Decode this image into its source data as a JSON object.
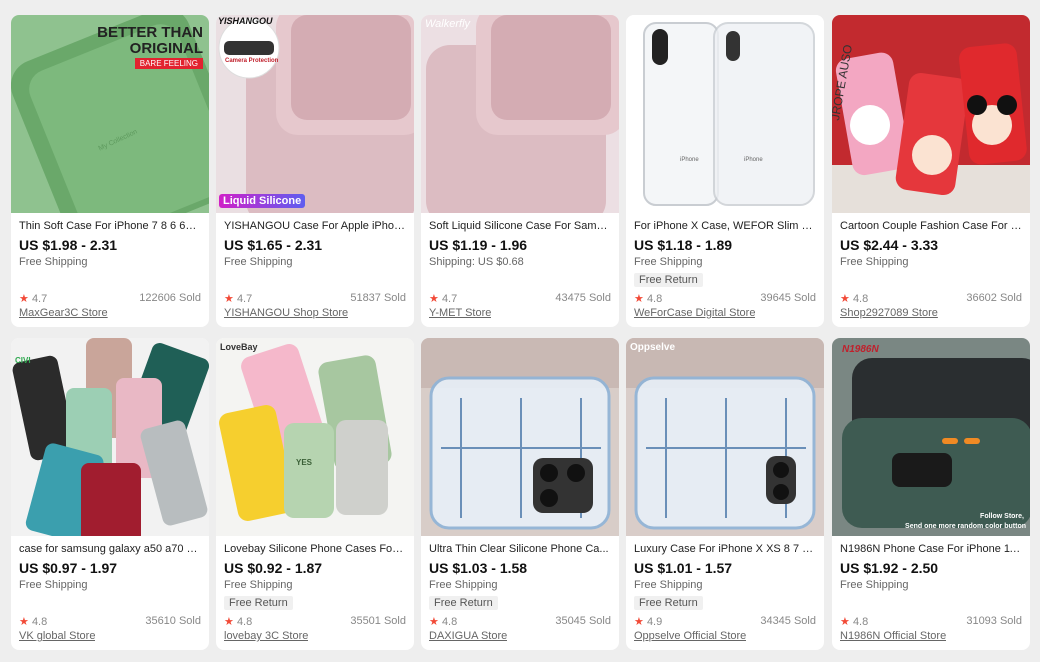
{
  "colors": {
    "price": "#111111",
    "star": "#f24a37",
    "background": "#eeeeee",
    "card": "#ffffff"
  },
  "products": [
    {
      "title": "Thin Soft Case For iPhone 7 8 6 6s ...",
      "price": "US $1.98 - 2.31",
      "shipping": "Free Shipping",
      "badge": "",
      "rating": "4.7",
      "sold": "122606 Sold",
      "store": "MaxGear3C Store",
      "overlay": {
        "headline1": "BETTER THAN",
        "headline2": "ORIGINAL",
        "tag": "BARE FEELING",
        "case_text": "My Collection"
      }
    },
    {
      "title": "YISHANGOU Case For Apple iPhon...",
      "price": "US $1.65 - 2.31",
      "shipping": "Free Shipping",
      "badge": "",
      "rating": "4.7",
      "sold": "51837 Sold",
      "store": "YISHANGOU Shop Store",
      "overlay": {
        "brand": "YISHANGOU",
        "circle_label": "Camera Protection",
        "bottom_label": "Liquid Silicone"
      }
    },
    {
      "title": "Soft Liquid Silicone Case For Sams...",
      "price": "US $1.19 - 1.96",
      "shipping": "Shipping: US $0.68",
      "badge": "",
      "rating": "4.7",
      "sold": "43475 Sold",
      "store": "Y-MET Store",
      "overlay": {
        "brand": "Walkerfly"
      }
    },
    {
      "title": "For iPhone X Case, WEFOR Slim Cle...",
      "price": "US $1.18 - 1.89",
      "shipping": "Free Shipping",
      "badge": "Free Return",
      "rating": "4.8",
      "sold": "39645 Sold",
      "store": "WeForCase Digital Store",
      "overlay": {
        "phone_text": "iPhone"
      }
    },
    {
      "title": "Cartoon Couple Fashion Case For i...",
      "price": "US $2.44 - 3.33",
      "shipping": "Free Shipping",
      "badge": "",
      "rating": "4.8",
      "sold": "36602 Sold",
      "store": "Shop2927089 Store",
      "overlay": {
        "side_text": "JROPE AUSO"
      }
    },
    {
      "title": "case for samsung galaxy a50 a70 a...",
      "price": "US $0.97 - 1.97",
      "shipping": "Free Shipping",
      "badge": "",
      "rating": "4.8",
      "sold": "35610 Sold",
      "store": "VK global Store",
      "overlay": {
        "brand": "CIVI"
      }
    },
    {
      "title": "Lovebay Silicone Phone Cases For i...",
      "price": "US $0.92 - 1.87",
      "shipping": "Free Shipping",
      "badge": "Free Return",
      "rating": "4.8",
      "sold": "35501 Sold",
      "store": "lovebay 3C Store",
      "overlay": {
        "brand": "LoveBay",
        "case_text": "YES"
      }
    },
    {
      "title": "Ultra Thin Clear Silicone Phone Ca...",
      "price": "US $1.03 - 1.58",
      "shipping": "Free Shipping",
      "badge": "Free Return",
      "rating": "4.8",
      "sold": "35045 Sold",
      "store": "DAXIGUA Store",
      "overlay": {}
    },
    {
      "title": "Luxury Case For iPhone X XS 8 7 6 ...",
      "price": "US $1.01 - 1.57",
      "shipping": "Free Shipping",
      "badge": "Free Return",
      "rating": "4.9",
      "sold": "34345 Sold",
      "store": "Oppselve Official Store",
      "overlay": {
        "brand": "Oppselve"
      }
    },
    {
      "title": "N1986N Phone Case For iPhone 11...",
      "price": "US $1.92 - 2.50",
      "shipping": "Free Shipping",
      "badge": "",
      "rating": "4.8",
      "sold": "31093 Sold",
      "store": "N1986N Official Store",
      "overlay": {
        "brand": "N1986N",
        "note1": "Follow Store,",
        "note2": "Send one more random color button"
      }
    }
  ]
}
